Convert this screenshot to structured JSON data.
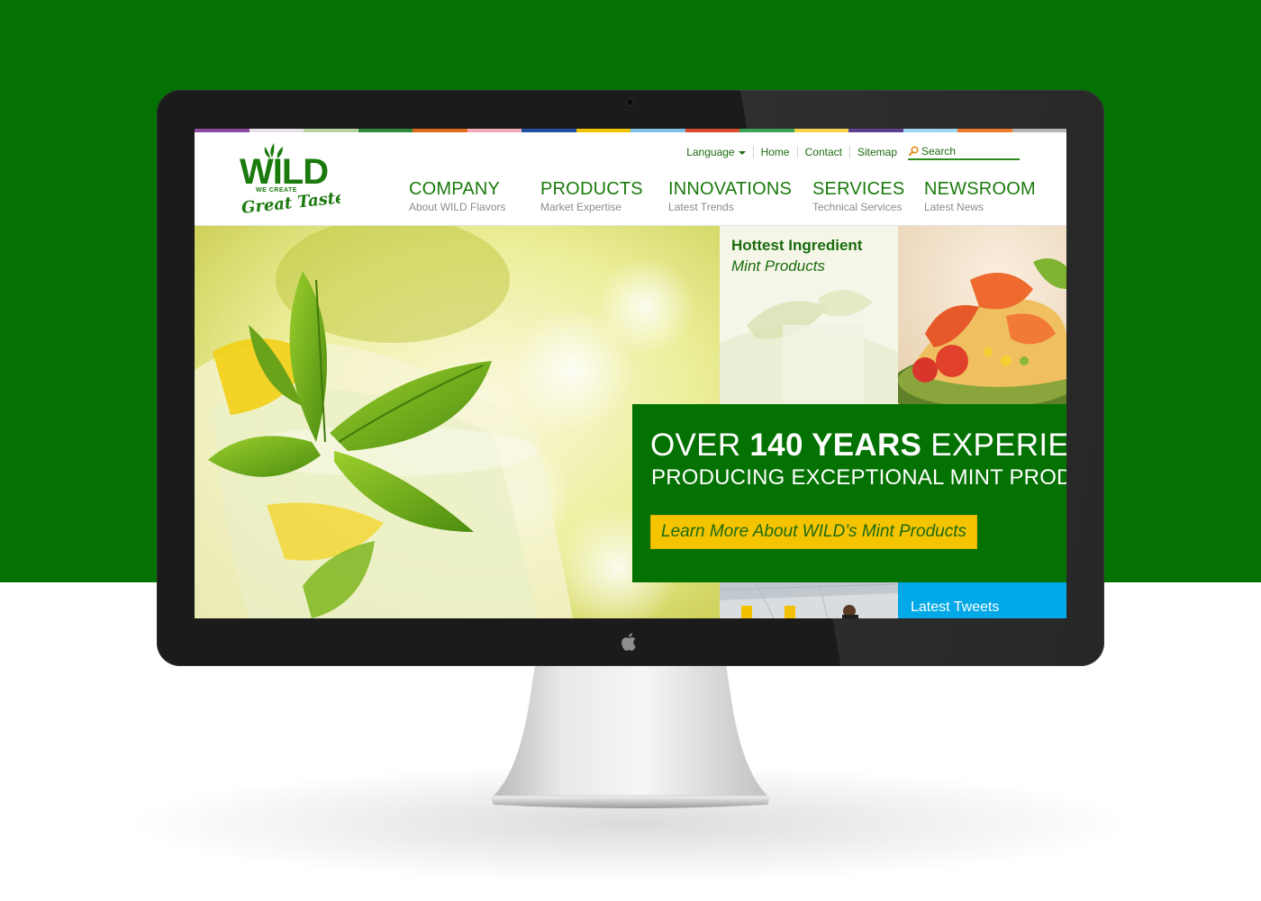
{
  "strip_colors": [
    "#8d4aa0",
    "#e8e1ea",
    "#b9d3a2",
    "#2d8a3c",
    "#e06a1f",
    "#f4a8b7",
    "#2050a0",
    "#f2c200",
    "#7cc0e8",
    "#d94c2b",
    "#3aa35a",
    "#f7d34a",
    "#5d3f8e",
    "#9fd5ef",
    "#ec7b2c",
    "#b5b5b5"
  ],
  "logo": {
    "brand": "WILD",
    "tagline_top": "WE CREATE",
    "tagline_script": "Great Taste"
  },
  "utility_nav": {
    "language_label": "Language",
    "home_label": "Home",
    "contact_label": "Contact",
    "sitemap_label": "Sitemap",
    "search_placeholder": "Search"
  },
  "main_nav": [
    {
      "title": "COMPANY",
      "subtitle": "About WILD Flavors"
    },
    {
      "title": "PRODUCTS",
      "subtitle": "Market Expertise"
    },
    {
      "title": "INNOVATIONS",
      "subtitle": "Latest Trends"
    },
    {
      "title": "SERVICES",
      "subtitle": "Technical Services"
    },
    {
      "title": "NEWSROOM",
      "subtitle": "Latest News"
    }
  ],
  "hottest": {
    "title": "Hottest Ingredient",
    "subtitle": "Mint Products"
  },
  "promo": {
    "line1_pre": "OVER ",
    "line1_bold": "140 YEARS",
    "line1_post": " EXPERIENCE",
    "line2": "PRODUCING EXCEPTIONAL MINT PRODUCTS",
    "cta_label": "Learn More About WILD’s Mint Products"
  },
  "tweets": {
    "label": "Latest Tweets"
  },
  "colors": {
    "brand_green": "#047202",
    "accent_yellow": "#f5c400",
    "tweets_blue": "#00a8e8"
  }
}
